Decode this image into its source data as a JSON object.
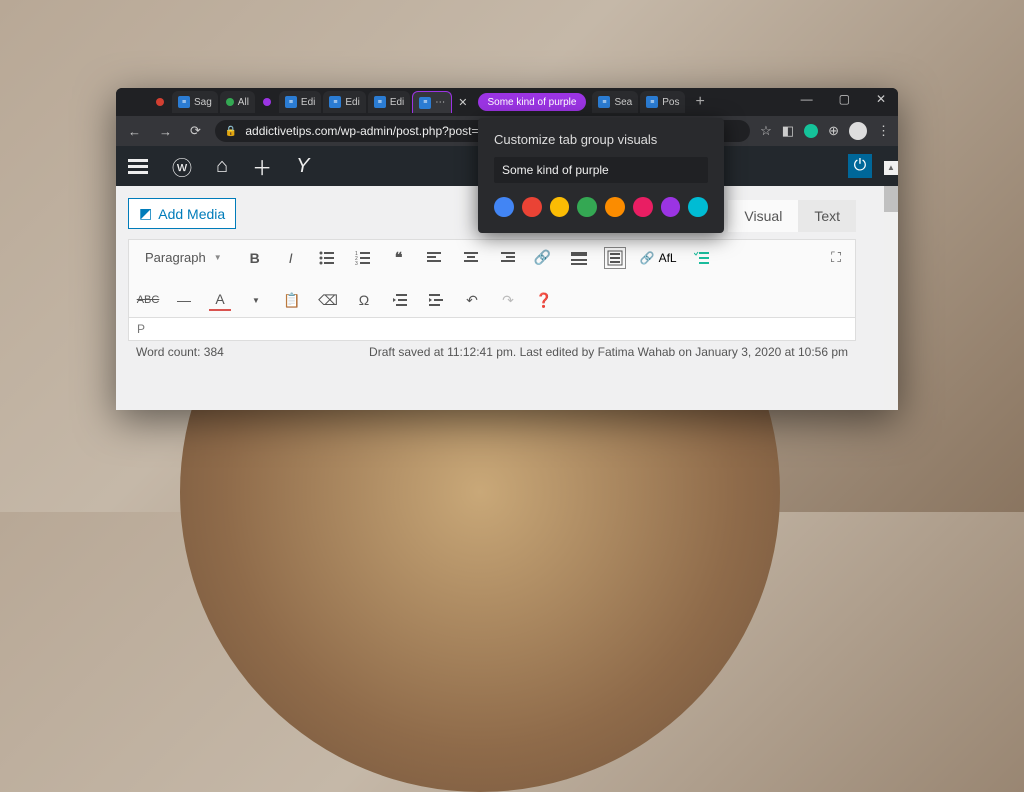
{
  "browser": {
    "tabs": [
      {
        "label": "",
        "color": "#d23f31"
      },
      {
        "label": "Sag",
        "favicon": true
      },
      {
        "label": "All",
        "color": "#34a853",
        "favicon": true
      },
      {
        "label": "",
        "color": "#9b34e3"
      },
      {
        "label": "Edi",
        "favicon": true
      },
      {
        "label": "Edi",
        "favicon": true
      },
      {
        "label": "Edi",
        "favicon": true
      }
    ],
    "active_tab_icon": "⋯",
    "group_label": "Some kind of purple",
    "tabs_right": [
      {
        "label": "Sea",
        "favicon": true
      },
      {
        "label": "Pos",
        "favicon": true
      }
    ],
    "url": "addictivetips.com/wp-admin/post.php?post="
  },
  "popover": {
    "title": "Customize tab group visuals",
    "value": "Some kind of purple",
    "colors": [
      "#4285f4",
      "#ea4335",
      "#fbbc04",
      "#34a853",
      "#fb8c00",
      "#e91e63",
      "#9b34e3",
      "#00bcd4"
    ]
  },
  "editor": {
    "add_media": "Add Media",
    "tabs": {
      "visual": "Visual",
      "text": "Text"
    },
    "format": "Paragraph",
    "afl": "AfL",
    "path": "P",
    "wordcount": "Word count: 384",
    "draft": "Draft saved at 11:12:41 pm. Last edited by Fatima Wahab on January 3, 2020 at 10:56 pm"
  }
}
